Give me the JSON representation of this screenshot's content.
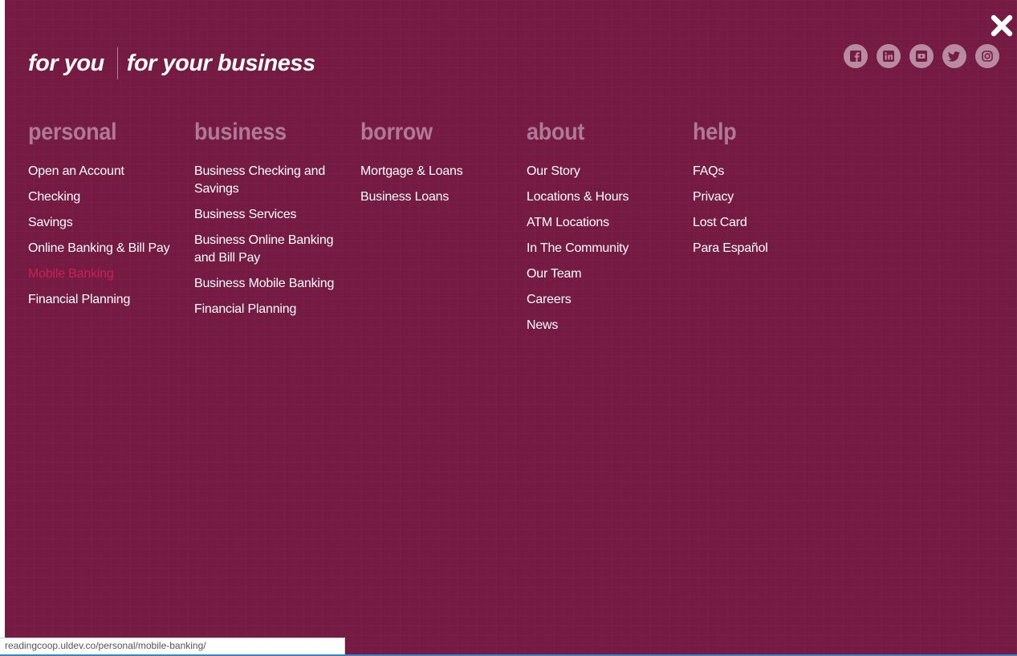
{
  "brand_tabs": [
    {
      "label": "for you"
    },
    {
      "label": "for your business"
    }
  ],
  "close_icon": "close-icon",
  "social_icons": [
    {
      "name": "facebook-icon"
    },
    {
      "name": "linkedin-icon"
    },
    {
      "name": "youtube-icon"
    },
    {
      "name": "twitter-icon"
    },
    {
      "name": "instagram-icon"
    }
  ],
  "menu": {
    "columns": [
      {
        "heading": "personal",
        "links": [
          "Open an Account",
          "Checking",
          "Savings",
          "Online Banking & Bill Pay",
          "Mobile Banking",
          "Financial Planning"
        ]
      },
      {
        "heading": "business",
        "links": [
          "Business Checking and Savings",
          "Business Services",
          "Business Online Banking and Bill Pay",
          "Business Mobile Banking",
          "Financial Planning"
        ]
      },
      {
        "heading": "borrow",
        "links": [
          "Mortgage & Loans",
          "Business Loans"
        ]
      },
      {
        "heading": "about",
        "links": [
          "Our Story",
          "Locations & Hours",
          "ATM Locations",
          "In The Community",
          "Our Team",
          "Careers",
          "News"
        ]
      },
      {
        "heading": "help",
        "links": [
          "FAQs",
          "Privacy",
          "Lost Card",
          "Para Español"
        ]
      }
    ],
    "active_link": "Mobile Banking"
  },
  "status_bar": {
    "url": "readingcoop.uldev.co/personal/mobile-banking/"
  },
  "colors": {
    "background": "#741a43",
    "heading": "#b07a94",
    "link": "#ffffff",
    "active_link": "#c8234e",
    "social_icon_bg": "#b98ba0"
  }
}
